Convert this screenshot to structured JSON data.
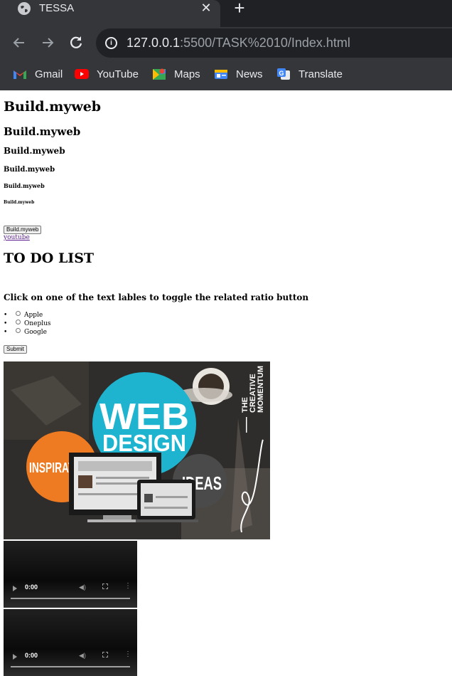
{
  "browser": {
    "tab_title": "TESSA",
    "url_host": "127.0.0.1",
    "url_rest": ":5500/TASK%2010/Index.html",
    "bookmarks": [
      "Gmail",
      "YouTube",
      "Maps",
      "News",
      "Translate"
    ]
  },
  "page": {
    "headings": [
      "Build.myweb",
      "Build.myweb",
      "Build.myweb",
      "Build.myweb",
      "Build.myweb",
      "Build.myweb"
    ],
    "build_button": "Build.myweb",
    "youtube_link": "youtube",
    "todo_title": "TO DO LIST",
    "prompt": "Click on one of the text lables to toggle the related ratio button",
    "options": [
      "Apple",
      "Oneplus",
      "Google"
    ],
    "submit_button": "Submit",
    "banner": {
      "web": "WEB",
      "design": "DESIGN",
      "inspiration": "INSPIRATION",
      "ideas": "IDEAS",
      "brand_lines": [
        "THE",
        "CREATIVE",
        "MOMENTUM"
      ]
    },
    "videos": [
      {
        "time": "0:00"
      },
      {
        "time": "0:00"
      }
    ]
  },
  "colors": {
    "chrome_bg": "#35363a",
    "tabstrip_bg": "#202124",
    "link_visited": "#551a8b",
    "banner_cyan": "#1eb3cf",
    "banner_orange": "#ee7a22"
  }
}
